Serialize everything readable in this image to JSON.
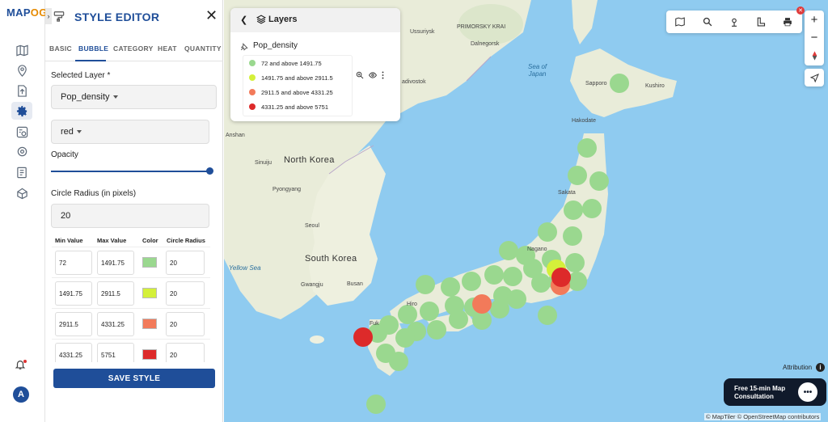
{
  "brand": {
    "logo_main": "MAP",
    "logo_accent": "OG"
  },
  "rail": {
    "items": [
      "map-icon",
      "marker-icon",
      "upload-icon",
      "gear-icon",
      "analysis-icon",
      "settings-icon",
      "report-icon",
      "share-icon"
    ],
    "active": "gear-icon",
    "avatar": "A"
  },
  "editor": {
    "title": "STYLE EDITOR",
    "collapse_glyph": "›",
    "close_glyph": "✕",
    "tabs": [
      "BASIC",
      "BUBBLE",
      "CATEGORY",
      "HEAT",
      "QUANTITY"
    ],
    "active_tab": "BUBBLE",
    "selected_layer_label": "Selected Layer *",
    "selected_layer_value": "Pop_density",
    "color_scheme_value": "red",
    "opacity_label": "Opacity",
    "opacity_value": 1.0,
    "radius_label": "Circle Radius (in pixels)",
    "radius_value": "20",
    "table_headers": [
      "Min Value",
      "Max Value",
      "Color",
      "Circle Radius"
    ],
    "rows": [
      {
        "min": "72",
        "max": "1491.75",
        "color": "#9ad88f",
        "radius": "20"
      },
      {
        "min": "1491.75",
        "max": "2911.5",
        "color": "#d4f03a",
        "radius": "20"
      },
      {
        "min": "2911.5",
        "max": "4331.25",
        "color": "#f27a5a",
        "radius": "20"
      },
      {
        "min": "4331.25",
        "max": "5751",
        "color": "#dd2a2a",
        "radius": "20"
      }
    ],
    "save_label": "SAVE STYLE"
  },
  "layers": {
    "title": "Layers",
    "layer_name": "Pop_density",
    "legend": [
      {
        "text": "72 and above 1491.75",
        "color": "#9ad88f"
      },
      {
        "text": "1491.75 and above 2911.5",
        "color": "#d4f03a"
      },
      {
        "text": "2911.5 and above 4331.25",
        "color": "#f27a5a"
      },
      {
        "text": "4331.25 and above 5751",
        "color": "#dd2a2a"
      }
    ]
  },
  "map": {
    "labels": {
      "primorsky": "PRIMORSKY KRAI",
      "ussuriysk": "Ussuriysk",
      "dalnegorsk": "Dalnegorsk",
      "vladivostok": "adivostok",
      "anshan": "Anshan",
      "sinuiju": "Sinuiju",
      "pyongyang": "Pyongyang",
      "seoul": "Seoul",
      "gwangju": "Gwangju",
      "busan": "Busan",
      "sapporo": "Sapporo",
      "kushiro": "Kushiro",
      "hakodate": "Hakodate",
      "sakata": "Sakata",
      "nagano": "Nagano",
      "hiro": "Hiro",
      "fuk": "Fuk"
    },
    "regions": {
      "north_korea": "North Korea",
      "south_korea": "South Korea"
    },
    "seas": {
      "japan": "Sea of\nJapan",
      "yellow": "Yellow Sea"
    },
    "attribution_label": "Attribution",
    "consult_label": "Free 15-min Map Consultation",
    "credits": "© MapTiler © OpenStreetMap contributors"
  },
  "toolbar": {
    "icons": [
      "map-book-icon",
      "search-icon",
      "pin-icon",
      "measure-icon",
      "print-icon"
    ],
    "zoom_in": "+",
    "zoom_out": "−"
  }
}
